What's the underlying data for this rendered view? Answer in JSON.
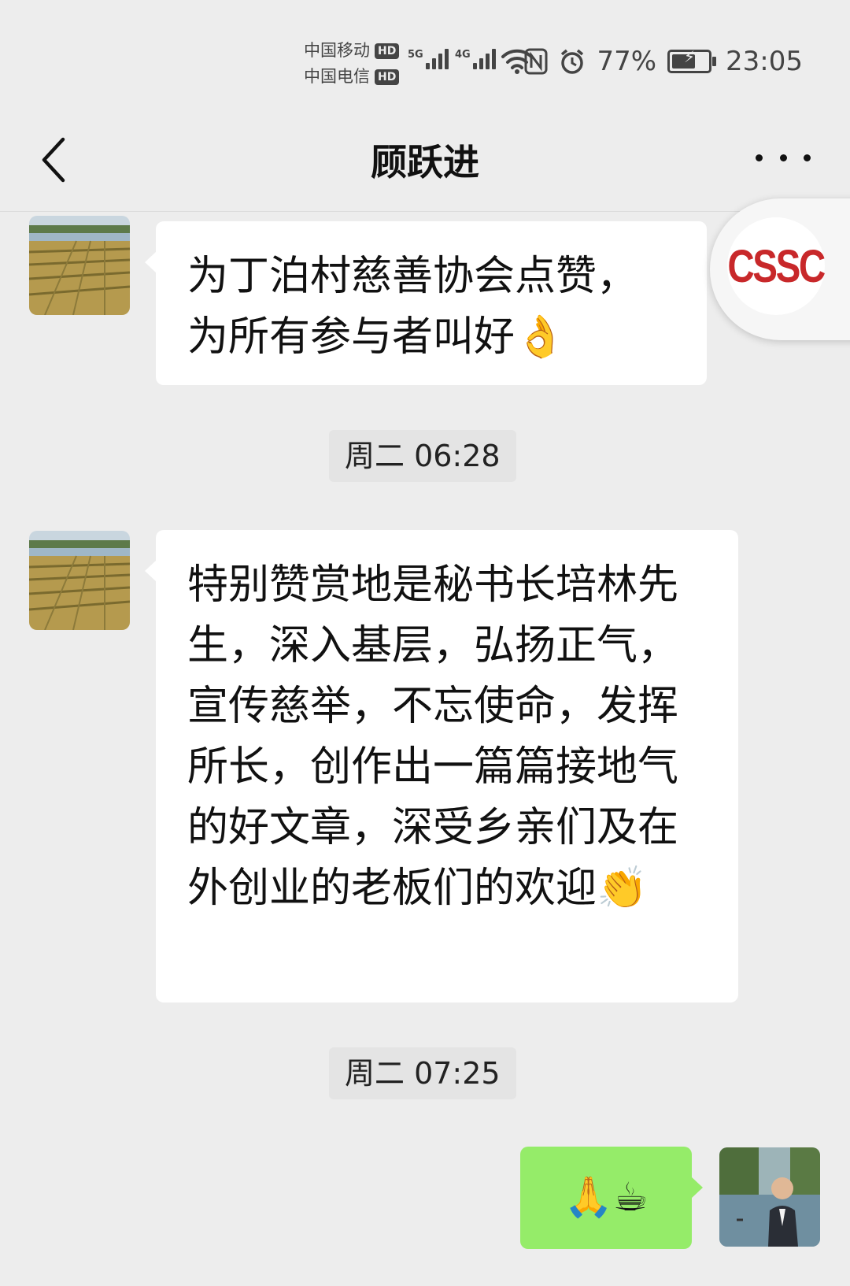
{
  "status_bar": {
    "carrier1": "中国移动",
    "carrier2": "中国电信",
    "hd_label": "HD",
    "sim1_network": "5G",
    "sim2_network": "4G",
    "battery_percent": "77%",
    "battery_level": 0.77,
    "time": "23:05"
  },
  "nav": {
    "title": "顾跃进"
  },
  "floating_badge": {
    "text": "CSSC",
    "color": "#c8282a"
  },
  "messages": [
    {
      "sender": "other",
      "text": "为丁泊村慈善协会点赞，为所有参与者叫好👌"
    },
    {
      "sender": "other",
      "text": "特别赞赏地是秘书长培林先生，深入基层，弘扬正气，宣传慈举，不忘使命，发挥所长，创作出一篇篇接地气的好文章，深受乡亲们及在外创业的老板们的欢迎👏"
    },
    {
      "sender": "self",
      "text": "🙏☕"
    }
  ],
  "timestamps": [
    "周二 06:28",
    "周二 07:25"
  ],
  "colors": {
    "background": "#ededed",
    "self_bubble": "#95ec69",
    "other_bubble": "#ffffff"
  }
}
